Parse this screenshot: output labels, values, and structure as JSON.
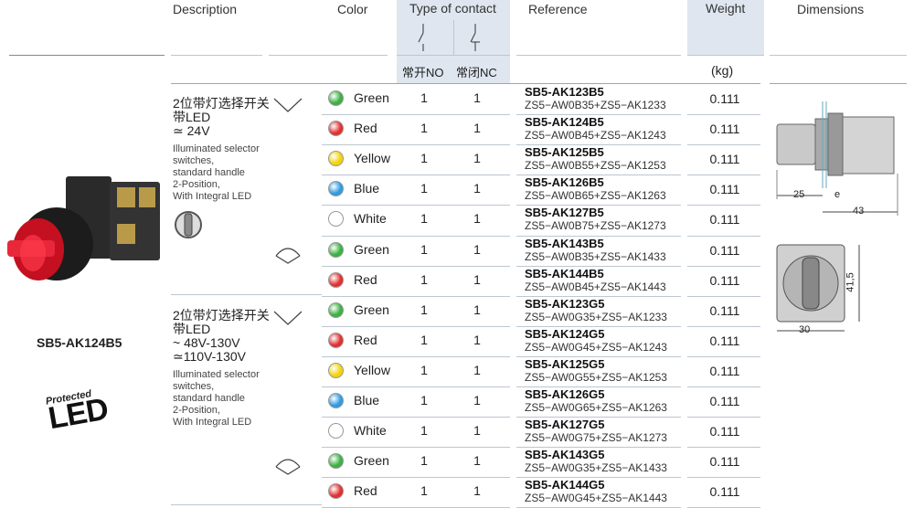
{
  "header": {
    "description": "Description",
    "color": "Color",
    "type_of_contact": "Type of contact",
    "reference": "Reference",
    "weight": "Weight",
    "dimensions": "Dimensions",
    "no_label": "常开NO",
    "nc_label": "常闭NC",
    "kg": "(kg)"
  },
  "product": {
    "name": "SB5-AK124B5",
    "badge_line1": "Protected",
    "badge_line2": "LED"
  },
  "groups": [
    {
      "cn": "2位带灯选择开关",
      "cn2": "带LED",
      "voltage": [
        "≃ 24V"
      ],
      "en": [
        "Illuminated selector",
        "switches,",
        "standard handle",
        "2-Position,",
        "With Integral LED"
      ]
    },
    {
      "cn": "2位带灯选择开关",
      "cn2": "带LED",
      "voltage": [
        "~ 48V-130V",
        "≃110V-130V"
      ],
      "en": [
        "Illuminated selector",
        "switches,",
        "standard handle",
        "2-Position,",
        "With Integral LED"
      ]
    }
  ],
  "rows": [
    {
      "color": "Green",
      "hex": "#3cb043",
      "no": "1",
      "nc": "1",
      "ref": "SB5-AK123B5",
      "sub": "ZS5−AW0B35+ZS5−AK1233",
      "kg": "0.111"
    },
    {
      "color": "Red",
      "hex": "#e03030",
      "no": "1",
      "nc": "1",
      "ref": "SB5-AK124B5",
      "sub": "ZS5−AW0B45+ZS5−AK1243",
      "kg": "0.111"
    },
    {
      "color": "Yellow",
      "hex": "#f2d40c",
      "no": "1",
      "nc": "1",
      "ref": "SB5-AK125B5",
      "sub": "ZS5−AW0B55+ZS5−AK1253",
      "kg": "0.111"
    },
    {
      "color": "Blue",
      "hex": "#2f9be0",
      "no": "1",
      "nc": "1",
      "ref": "SB5-AK126B5",
      "sub": "ZS5−AW0B65+ZS5−AK1263",
      "kg": "0.111"
    },
    {
      "color": "White",
      "hex": "#ffffff",
      "no": "1",
      "nc": "1",
      "ref": "SB5-AK127B5",
      "sub": "ZS5−AW0B75+ZS5−AK1273",
      "kg": "0.111"
    },
    {
      "color": "Green",
      "hex": "#3cb043",
      "no": "1",
      "nc": "1",
      "ref": "SB5-AK143B5",
      "sub": "ZS5−AW0B35+ZS5−AK1433",
      "kg": "0.111"
    },
    {
      "color": "Red",
      "hex": "#e03030",
      "no": "1",
      "nc": "1",
      "ref": "SB5-AK144B5",
      "sub": "ZS5−AW0B45+ZS5−AK1443",
      "kg": "0.111"
    },
    {
      "color": "Green",
      "hex": "#3cb043",
      "no": "1",
      "nc": "1",
      "ref": "SB5-AK123G5",
      "sub": "ZS5−AW0G35+ZS5−AK1233",
      "kg": "0.111"
    },
    {
      "color": "Red",
      "hex": "#e03030",
      "no": "1",
      "nc": "1",
      "ref": "SB5-AK124G5",
      "sub": "ZS5−AW0G45+ZS5−AK1243",
      "kg": "0.111"
    },
    {
      "color": "Yellow",
      "hex": "#f2d40c",
      "no": "1",
      "nc": "1",
      "ref": "SB5-AK125G5",
      "sub": "ZS5−AW0G55+ZS5−AK1253",
      "kg": "0.111"
    },
    {
      "color": "Blue",
      "hex": "#2f9be0",
      "no": "1",
      "nc": "1",
      "ref": "SB5-AK126G5",
      "sub": "ZS5−AW0G65+ZS5−AK1263",
      "kg": "0.111"
    },
    {
      "color": "White",
      "hex": "#ffffff",
      "no": "1",
      "nc": "1",
      "ref": "SB5-AK127G5",
      "sub": "ZS5−AW0G75+ZS5−AK1273",
      "kg": "0.111"
    },
    {
      "color": "Green",
      "hex": "#3cb043",
      "no": "1",
      "nc": "1",
      "ref": "SB5-AK143G5",
      "sub": "ZS5−AW0G35+ZS5−AK1433",
      "kg": "0.111"
    },
    {
      "color": "Red",
      "hex": "#e03030",
      "no": "1",
      "nc": "1",
      "ref": "SB5-AK144G5",
      "sub": "ZS5−AW0G45+ZS5−AK1443",
      "kg": "0.111"
    }
  ],
  "dimensions": {
    "d25": "25",
    "de": "e",
    "d43": "43",
    "d41_5": "41,5",
    "d30": "30"
  }
}
